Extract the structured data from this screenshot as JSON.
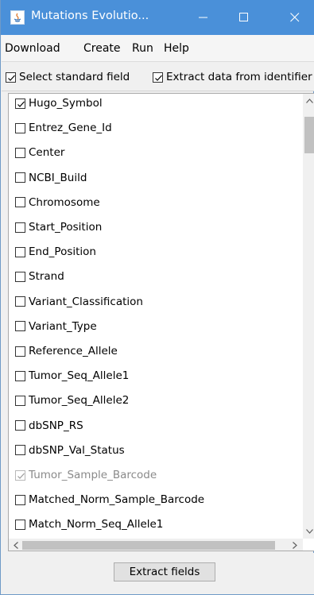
{
  "window": {
    "title": "Mutations Evolutio...",
    "minimize_glyph": "—",
    "maximize_glyph": "☐",
    "close_glyph": "✕",
    "icon": "java-app-icon"
  },
  "menu": {
    "items": [
      {
        "label": "Download"
      },
      {
        "label": "Create"
      },
      {
        "label": "Run"
      },
      {
        "label": "Help"
      }
    ]
  },
  "options": {
    "select_standard_field": {
      "label": "Select standard field",
      "checked": true
    },
    "extract_data": {
      "label": "Extract data from identifier",
      "checked": true
    }
  },
  "fields": [
    {
      "label": "Hugo_Symbol",
      "checked": true,
      "disabled": false
    },
    {
      "label": "Entrez_Gene_Id",
      "checked": false,
      "disabled": false
    },
    {
      "label": "Center",
      "checked": false,
      "disabled": false
    },
    {
      "label": "NCBI_Build",
      "checked": false,
      "disabled": false
    },
    {
      "label": "Chromosome",
      "checked": false,
      "disabled": false
    },
    {
      "label": "Start_Position",
      "checked": false,
      "disabled": false
    },
    {
      "label": "End_Position",
      "checked": false,
      "disabled": false
    },
    {
      "label": "Strand",
      "checked": false,
      "disabled": false
    },
    {
      "label": "Variant_Classification",
      "checked": false,
      "disabled": false
    },
    {
      "label": "Variant_Type",
      "checked": false,
      "disabled": false
    },
    {
      "label": "Reference_Allele",
      "checked": false,
      "disabled": false
    },
    {
      "label": "Tumor_Seq_Allele1",
      "checked": false,
      "disabled": false
    },
    {
      "label": "Tumor_Seq_Allele2",
      "checked": false,
      "disabled": false
    },
    {
      "label": "dbSNP_RS",
      "checked": false,
      "disabled": false
    },
    {
      "label": "dbSNP_Val_Status",
      "checked": false,
      "disabled": false
    },
    {
      "label": "Tumor_Sample_Barcode",
      "checked": true,
      "disabled": true
    },
    {
      "label": "Matched_Norm_Sample_Barcode",
      "checked": false,
      "disabled": false
    },
    {
      "label": "Match_Norm_Seq_Allele1",
      "checked": false,
      "disabled": false
    }
  ],
  "scrollbars": {
    "up_arrow": "chevron-up-icon",
    "down_arrow": "chevron-down-icon",
    "left_arrow": "chevron-left-icon",
    "right_arrow": "chevron-right-icon"
  },
  "actions": {
    "extract_fields": "Extract fields"
  },
  "colors": {
    "titlebar": "#4a90d9",
    "window_background": "#f0f0f0",
    "list_background": "#ffffff",
    "disabled_text": "#8a8a8a"
  }
}
